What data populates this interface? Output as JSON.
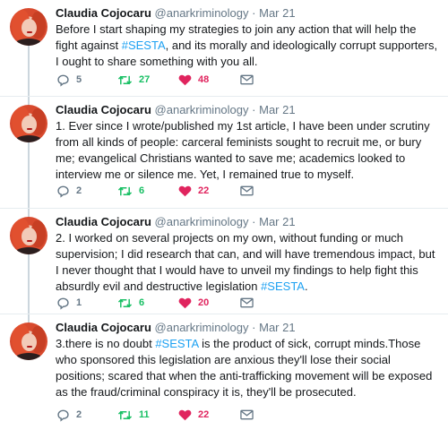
{
  "colors": {
    "hashtag": "#1da1f2",
    "retweet": "#17bf63",
    "like": "#e0245e",
    "muted": "#657786"
  },
  "tweets": [
    {
      "display_name": "Claudia Cojocaru",
      "handle": "@anarkriminology",
      "separator": "·",
      "date": "Mar 21",
      "text_parts": [
        "Before I start shaping my strategies to join any action that will help the fight against ",
        "#SESTA",
        ", and its morally and ideologically corrupt supporters,  I ought to share something with you all."
      ],
      "replies": "5",
      "retweets": "27",
      "likes": "48",
      "icons": {
        "reply": "reply-icon",
        "retweet": "retweet-icon",
        "like": "heart-icon",
        "dm": "envelope-icon"
      }
    },
    {
      "display_name": "Claudia Cojocaru",
      "handle": "@anarkriminology",
      "separator": "·",
      "date": "Mar 21",
      "text_parts": [
        "1. Ever since I wrote/published my 1st article, I have been under scrutiny from all kinds of people: carceral feminists sought to recruit me, or bury me; evangelical Christians wanted to save me; academics looked to interview me or silence me. Yet, I remained true to myself."
      ],
      "replies": "2",
      "retweets": "6",
      "likes": "22"
    },
    {
      "display_name": "Claudia Cojocaru",
      "handle": "@anarkriminology",
      "separator": "·",
      "date": "Mar 21",
      "text_parts": [
        "2. I worked on several projects on my own, without funding or much supervision; I did research that can, and will have tremendous impact, but I never thought that I would have to unveil my findings to help fight  this absurdly evil and destructive legislation ",
        "#SESTA",
        "."
      ],
      "replies": "1",
      "retweets": "6",
      "likes": "20"
    },
    {
      "display_name": "Claudia Cojocaru",
      "handle": "@anarkriminology",
      "separator": "·",
      "date": "Mar 21",
      "text_parts": [
        "3.there is no doubt  ",
        "#SESTA",
        " is the product of sick, corrupt minds.Those who sponsored this legislation are anxious they'll lose their social positions; scared that when the anti-trafficking movement will be exposed as the fraud/criminal conspiracy it is, they'll be prosecuted."
      ],
      "replies": "2",
      "retweets": "11",
      "likes": "22"
    }
  ]
}
